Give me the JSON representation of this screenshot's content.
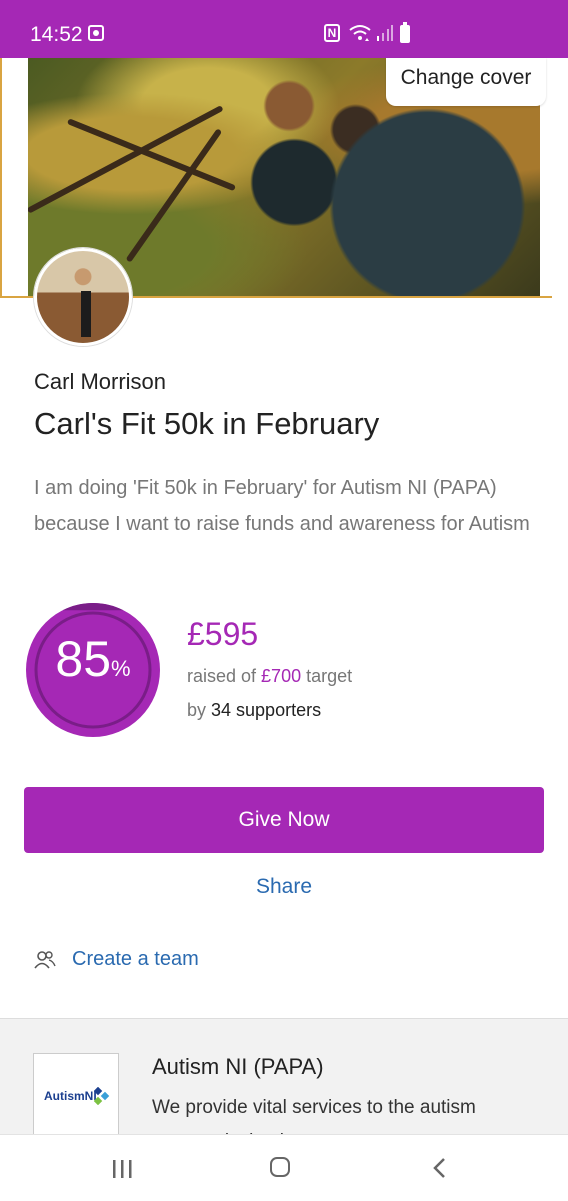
{
  "status_bar": {
    "time": "14:52",
    "nfc_label": "N",
    "icons": [
      "notification-icon",
      "nfc-icon",
      "wifi-icon",
      "signal-icon",
      "battery-icon"
    ]
  },
  "cover": {
    "change_cover_label": "Change cover"
  },
  "fundraiser": {
    "owner_name": "Carl Morrison",
    "title": "Carl's Fit 50k in February",
    "description": "I am doing 'Fit 50k in February' for Autism NI (PAPA) because I want to raise funds and awareness for Autism"
  },
  "progress": {
    "percent": 85,
    "percent_text": "85",
    "percent_symbol": "%",
    "raised": "£595",
    "raised_prefix": "raised of ",
    "target": "£700",
    "target_suffix": " target",
    "by_prefix": "by ",
    "supporters": "34 supporters"
  },
  "actions": {
    "give_now": "Give Now",
    "share": "Share",
    "create_team": "Create a team"
  },
  "charity": {
    "logo_text": "AutismNI",
    "name": "Autism NI (PAPA)",
    "description": "We provide vital services to the autism community in ni"
  },
  "colors": {
    "primary": "#a528b5",
    "link": "#2a6ab0",
    "accent_line": "#d9a441"
  },
  "nav": {
    "icons": [
      "recents-icon",
      "home-icon",
      "back-icon"
    ]
  }
}
